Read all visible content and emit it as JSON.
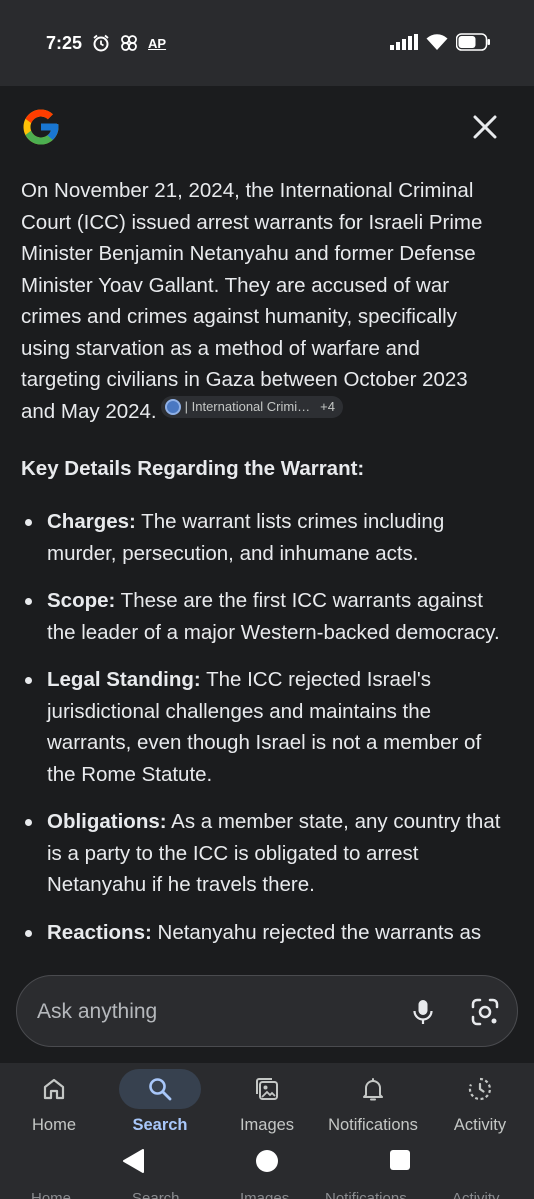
{
  "status_bar": {
    "time": "7:25",
    "ap_label": "AP",
    "icons_left": [
      "alarm-icon",
      "pinwheel-icon",
      "ap-icon"
    ],
    "icons_right": [
      "signal-icon",
      "wifi-icon",
      "battery-icon"
    ]
  },
  "panel": {
    "logo": "google-g-icon",
    "close_icon": "close-icon",
    "intro": "On November 21, 2024, the International Criminal Court (ICC) issued arrest warrants for Israeli Prime Minister Benjamin Netanyahu and former Defense Minister Yoav Gallant. They are accused of war crimes and crimes against humanity, specifically using starvation as a method of warfare and targeting civilians in Gaza between October 2023 and May 2024.",
    "source_chip": {
      "label": "| International Crimi…",
      "extra": "+4"
    },
    "heading": "Key Details Regarding the Warrant:",
    "bullets": [
      {
        "term": "Charges:",
        "text": " The warrant lists crimes including murder, persecution, and inhumane acts."
      },
      {
        "term": "Scope:",
        "text": " These are the first ICC warrants against the leader of a major Western-backed democracy."
      },
      {
        "term": "Legal Standing:",
        "text": " The ICC rejected Israel's jurisdictional challenges and maintains the warrants, even though Israel is not a member of the Rome Statute."
      },
      {
        "term": "Obligations:",
        "text": " As a member state, any country that is a party to the ICC is obligated to arrest Netanyahu if he travels there."
      },
      {
        "term": "Reactions:",
        "text": " Netanyahu rejected the warrants as"
      }
    ]
  },
  "ask_bar": {
    "placeholder": "Ask anything"
  },
  "bottom_nav": {
    "items": [
      {
        "label": "Home",
        "icon": "home-icon"
      },
      {
        "label": "Search",
        "icon": "search-icon"
      },
      {
        "label": "Images",
        "icon": "images-icon"
      },
      {
        "label": "Notifications",
        "icon": "bell-icon"
      },
      {
        "label": "Activity",
        "icon": "activity-icon"
      }
    ],
    "active": "Search"
  },
  "colors": {
    "background": "#1b1c1e",
    "active_accent": "#a8c7fa",
    "active_pill": "#37414f"
  }
}
